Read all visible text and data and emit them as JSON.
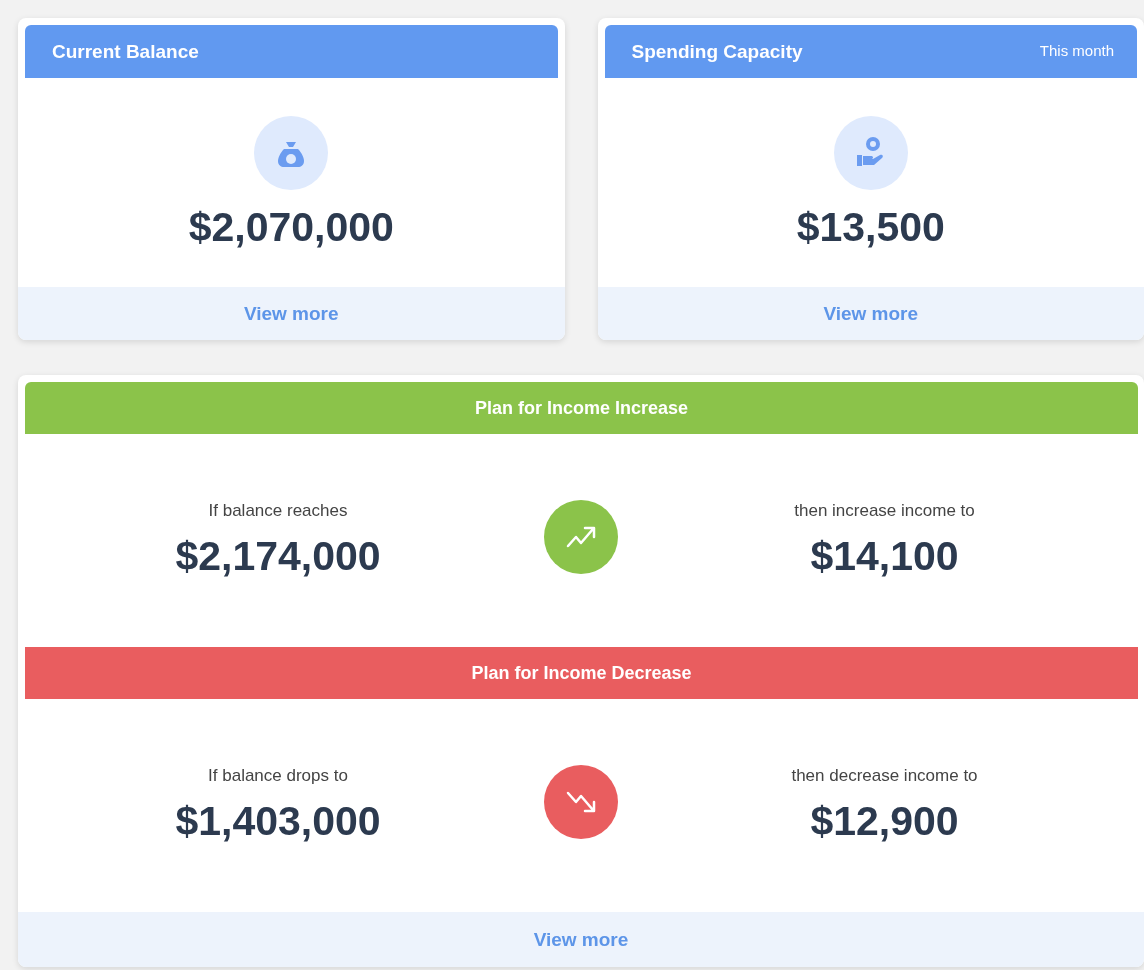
{
  "cards": [
    {
      "kind": "balance",
      "title": "Current Balance",
      "amount": "$2,070,000",
      "link": "View more"
    },
    {
      "kind": "capacity",
      "title": "Spending Capacity",
      "period": "This month",
      "amount": "$13,500",
      "link": "View more"
    }
  ],
  "plans": [
    {
      "kind": "increase",
      "title": "Plan for Income Increase",
      "condition_label": "If balance reaches",
      "condition_amount": "$2,174,000",
      "action_label": "then increase income to",
      "action_amount": "$14,100"
    },
    {
      "kind": "decrease",
      "title": "Plan for Income Decrease",
      "condition_label": "If balance drops to",
      "condition_amount": "$1,403,000",
      "action_label": "then decrease income to",
      "action_amount": "$12,900"
    }
  ],
  "plans_link": "View more"
}
